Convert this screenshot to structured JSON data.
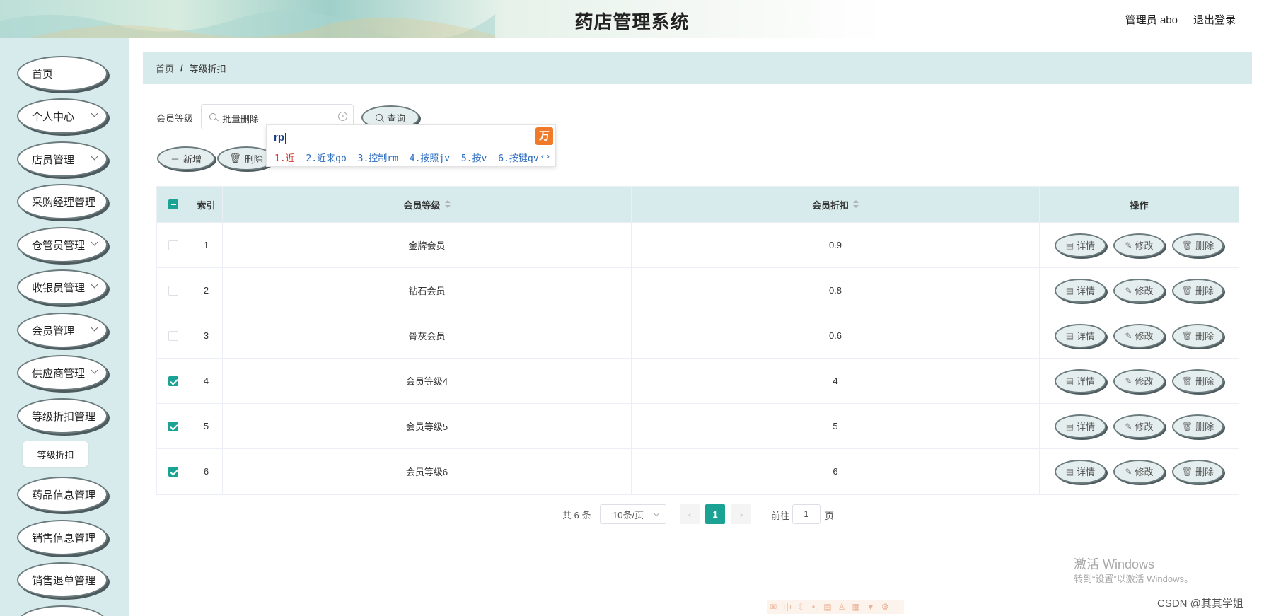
{
  "header": {
    "title": "药店管理系统",
    "user": "管理员 abo",
    "logout": "退出登录"
  },
  "sidebar": {
    "items": [
      {
        "label": "首页",
        "has_children": false
      },
      {
        "label": "个人中心",
        "has_children": true
      },
      {
        "label": "店员管理",
        "has_children": true
      },
      {
        "label": "采购经理管理",
        "has_children": false
      },
      {
        "label": "仓管员管理",
        "has_children": true
      },
      {
        "label": "收银员管理",
        "has_children": true
      },
      {
        "label": "会员管理",
        "has_children": true
      },
      {
        "label": "供应商管理",
        "has_children": true
      },
      {
        "label": "等级折扣管理",
        "has_children": false
      },
      {
        "label": "药品信息管理",
        "has_children": false
      },
      {
        "label": "销售信息管理",
        "has_children": false
      },
      {
        "label": "销售退单管理",
        "has_children": false
      }
    ],
    "active_sub": "等级折扣"
  },
  "breadcrumb": {
    "home": "首页",
    "separator": "/",
    "current": "等级折扣"
  },
  "search": {
    "label": "会员等级",
    "value": "批量删除",
    "query_button": "查询"
  },
  "toolbar": {
    "add": "新增",
    "delete": "删除"
  },
  "ime": {
    "composition": "rp",
    "candidates": [
      "1.近",
      "2.近来go",
      "3.控制rm",
      "4.按照jv",
      "5.按v",
      "6.按键qv"
    ],
    "nav": "‹ ›"
  },
  "table": {
    "headers": {
      "index": "索引",
      "level": "会员等级",
      "discount": "会员折扣",
      "actions": "操作"
    },
    "rows": [
      {
        "index": "1",
        "level": "金牌会员",
        "discount": "0.9",
        "checked": false
      },
      {
        "index": "2",
        "level": "钻石会员",
        "discount": "0.8",
        "checked": false
      },
      {
        "index": "3",
        "level": "骨灰会员",
        "discount": "0.6",
        "checked": false
      },
      {
        "index": "4",
        "level": "会员等级4",
        "discount": "4",
        "checked": true
      },
      {
        "index": "5",
        "level": "会员等级5",
        "discount": "5",
        "checked": true
      },
      {
        "index": "6",
        "level": "会员等级6",
        "discount": "6",
        "checked": true
      }
    ],
    "row_actions": {
      "detail": "详情",
      "edit": "修改",
      "delete": "删除"
    },
    "header_checkbox_state": "indeterminate"
  },
  "pagination": {
    "total": "共 6 条",
    "page_size": "10条/页",
    "current_page": "1",
    "goto_prefix": "前往",
    "goto_value": "1",
    "goto_suffix": "页"
  },
  "watermark": {
    "title": "激活 Windows",
    "subtitle": "转到“设置”以激活 Windows。"
  },
  "credit": "CSDN @其其学姐",
  "colors": {
    "accent": "#1aa394",
    "panel": "#d8ebec",
    "button_border": "#6b7b7e"
  }
}
